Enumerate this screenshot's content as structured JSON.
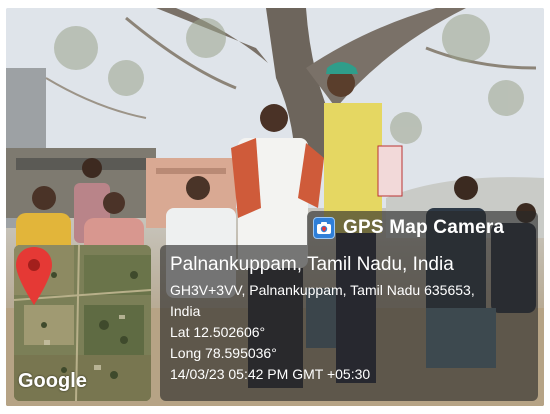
{
  "overlay": {
    "app_title": "GPS Map Camera",
    "app_icon": "map-camera-icon",
    "map_logo": "Google",
    "map_pin_icon": "map-pin-icon",
    "location_title": "Palnankuppam, Tamil Nadu, India",
    "address_line_1": "GH3V+3VV, Palnankuppam, Tamil Nadu 635653,",
    "address_line_2": "India",
    "latitude": "Lat 12.502606°",
    "longitude": "Long 78.595036°",
    "timestamp": "14/03/23 05:42 PM GMT +05:30"
  },
  "colors": {
    "overlay_bg": "#282828",
    "pin_red": "#e53935",
    "app_icon_blue": "#2f7fd8",
    "text": "#ffffff"
  }
}
